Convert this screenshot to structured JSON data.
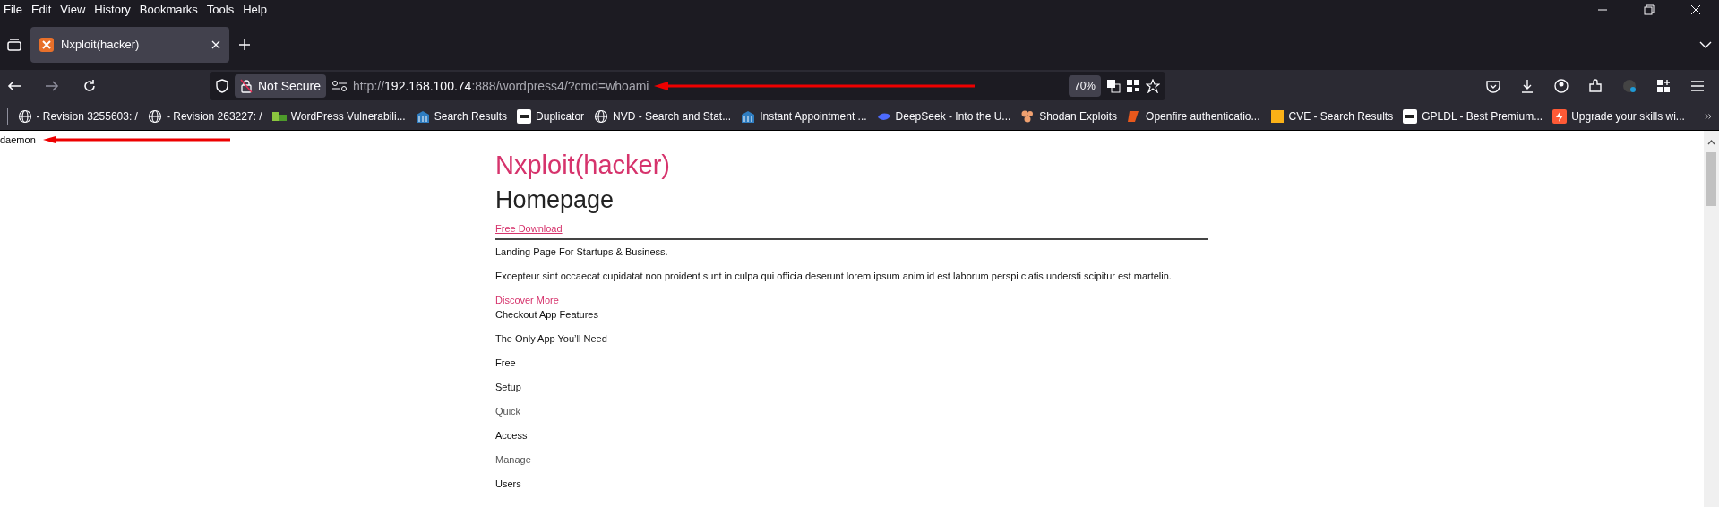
{
  "menu_bar": [
    "File",
    "Edit",
    "View",
    "History",
    "Bookmarks",
    "Tools",
    "Help"
  ],
  "tabs": [
    {
      "title": "Nxploit(hacker)",
      "selected": true
    }
  ],
  "nav": {
    "security_label": "Not Secure",
    "url_scheme": "http://",
    "url_host": "192.168.100.74",
    "url_rest": ":888/wordpress4/?cmd=whoami",
    "zoom": "70%"
  },
  "bookmarks": [
    {
      "label": "- Revision 3255603: /"
    },
    {
      "label": "- Revision 263227: /"
    },
    {
      "label": "WordPress Vulnerabili..."
    },
    {
      "label": "Search Results"
    },
    {
      "label": "Duplicator"
    },
    {
      "label": "NVD - Search and Stat..."
    },
    {
      "label": "Instant Appointment ..."
    },
    {
      "label": "DeepSeek - Into the U..."
    },
    {
      "label": "Shodan Exploits"
    },
    {
      "label": "Openfire authenticatio..."
    },
    {
      "label": "CVE - Search Results"
    },
    {
      "label": "GPLDL - Best Premium..."
    },
    {
      "label": "Upgrade your skills wi..."
    }
  ],
  "page": {
    "output": "daemon",
    "site_title": "Nxploit(hacker)",
    "heading": "Homepage",
    "blocks": [
      {
        "kind": "link",
        "text": "Free Download"
      },
      {
        "kind": "rule"
      },
      {
        "kind": "text",
        "text": "Landing Page For Startups & Business.",
        "muted": false
      },
      {
        "kind": "text",
        "text": "Excepteur sint occaecat cupidatat non proident sunt in culpa qui officia deserunt lorem ipsum anim id est laborum perspi ciatis understi scipitur est martelin.",
        "muted": false
      },
      {
        "kind": "link",
        "text": "Discover More"
      },
      {
        "kind": "text",
        "text": "Checkout App Features",
        "muted": false
      },
      {
        "kind": "text",
        "text": "The Only App You’ll Need",
        "muted": false
      },
      {
        "kind": "text",
        "text": "Free",
        "muted": false
      },
      {
        "kind": "text",
        "text": "Setup",
        "muted": false
      },
      {
        "kind": "text",
        "text": "Quick",
        "muted": true
      },
      {
        "kind": "text",
        "text": "Access",
        "muted": false
      },
      {
        "kind": "text",
        "text": "Manage",
        "muted": true
      },
      {
        "kind": "text",
        "text": "Users",
        "muted": false
      }
    ]
  }
}
